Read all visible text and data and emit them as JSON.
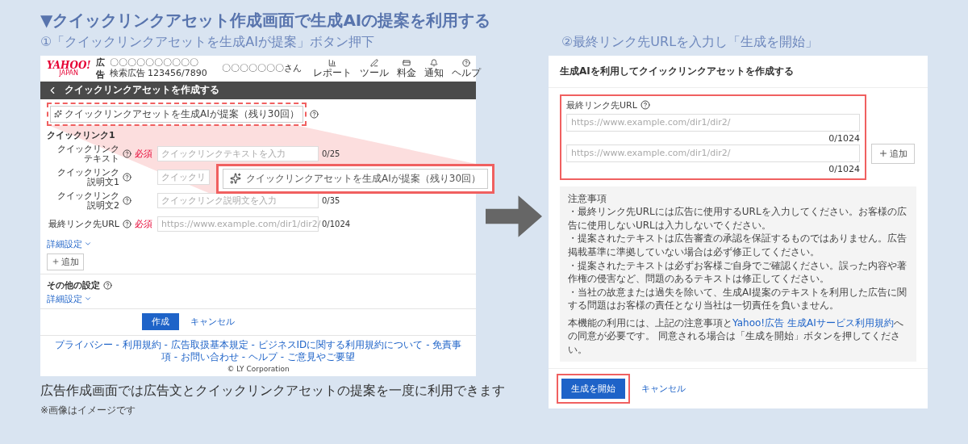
{
  "heading": "▼クイックリンクアセット作成画面で生成AIの提案を利用する",
  "steps": [
    {
      "label": "①「クイックリンクアセットを生成AIが提案」ボタン押下"
    },
    {
      "label": "②最終リンク先URLを入力し「生成を開始」"
    }
  ],
  "mock": {
    "header": {
      "logo": "YAHOO!",
      "logo_sub": "JAPAN",
      "product": "広告",
      "account_name": "〇〇〇〇〇〇〇〇〇〇",
      "account_id": "検索広告 123456/7890",
      "user": "〇〇〇〇〇〇〇さん",
      "nav": [
        {
          "label": "レポート"
        },
        {
          "label": "ツール"
        },
        {
          "label": "料金"
        },
        {
          "label": "通知"
        },
        {
          "label": "ヘルプ"
        }
      ]
    },
    "title": "クイックリンクアセットを作成する",
    "ai_button": "クイックリンクアセットを生成AIが提案（残り30回）",
    "section": "クイックリンク1",
    "fields": [
      {
        "label_lines": [
          "クイックリンク",
          "テキスト"
        ],
        "required_tag": "必須",
        "placeholder": "クイックリンクテキストを入力",
        "counter": "0/25"
      },
      {
        "label_lines": [
          "クイックリンク",
          "説明文1"
        ],
        "placeholder": "クイックリ"
      },
      {
        "label_lines": [
          "クイックリンク",
          "説明文2"
        ],
        "placeholder": "クイックリンク説明文を入力",
        "counter": "0/35"
      },
      {
        "label_lines": [
          "最終リンク先URL"
        ],
        "required_tag": "必須",
        "placeholder": "https://www.example.com/dir1/dir2/",
        "counter": "0/1024"
      }
    ],
    "details_link": "詳細設定",
    "add_button": "追加",
    "other_section": "その他の設定",
    "other_details_link": "詳細設定",
    "create_button": "作成",
    "cancel_link": "キャンセル",
    "footer_links": "プライバシー - 利用規約 - 広告取扱基本規定 - ビジネスIDに関する利用規約について - 免責事項 - お問い合わせ - ヘルプ - ご意見やご要望",
    "copyright": "© LY Corporation"
  },
  "callout": {
    "label": "クイックリンクアセットを生成AIが提案（残り30回）"
  },
  "caption": "広告作成画面では広告文とクイックリンクアセットの提案を一度に利用できます",
  "note": "※画像はイメージです",
  "dialog": {
    "title": "生成AIを利用してクイックリンクアセットを作成する",
    "url_label": "最終リンク先URL",
    "url_inputs": [
      {
        "placeholder": "https://www.example.com/dir1/dir2/",
        "counter": "0/1024"
      },
      {
        "placeholder": "https://www.example.com/dir1/dir2/",
        "counter": "0/1024"
      }
    ],
    "add_button": "追加",
    "notice": {
      "title": "注意事項",
      "items": [
        "・最終リンク先URLには広告に使用するURLを入力してください。お客様の広告に使用しないURLは入力しないでください。",
        "・提案されたテキストは広告審査の承認を保証するものではありません。広告掲載基準に準拠していない場合は必ず修正してください。",
        "・提案されたテキストは必ずお客様ご自身でご確認ください。誤った内容や著作権の侵害など、問題のあるテキストは修正してください。",
        "・当社の故意または過失を除いて、生成AI提案のテキストを利用した広告に関する問題はお客様の責任となり当社は一切責任を負いません。"
      ]
    },
    "consent": {
      "before": "本機能の利用には、上記の注意事項と",
      "link": "Yahoo!広告 生成AIサービス利用規約",
      "after": "への同意が必要です。 同意される場合は「生成を開始」ボタンを押してください。"
    },
    "start_button": "生成を開始",
    "cancel_link": "キャンセル"
  }
}
